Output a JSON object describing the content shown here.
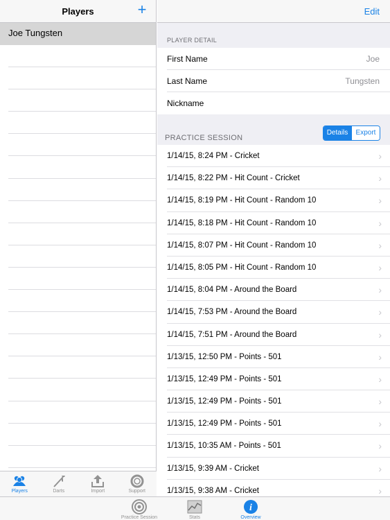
{
  "master": {
    "title": "Players",
    "add_symbol": "+",
    "players": [
      "Joe Tungsten"
    ],
    "empty_rows": 19,
    "tabs": [
      {
        "label": "Players",
        "icon": "players-icon",
        "active": true
      },
      {
        "label": "Darts",
        "icon": "dart-icon",
        "active": false
      },
      {
        "label": "Import",
        "icon": "import-icon",
        "active": false
      },
      {
        "label": "Support",
        "icon": "lifebuoy-icon",
        "active": false
      }
    ]
  },
  "detail": {
    "edit_label": "Edit",
    "player_detail_header": "PLAYER DETAIL",
    "fields": [
      {
        "label": "First Name",
        "value": "Joe"
      },
      {
        "label": "Last Name",
        "value": "Tungsten"
      },
      {
        "label": "Nickname",
        "value": ""
      }
    ],
    "practice_header": "PRACTICE SESSION",
    "segment": {
      "details": "Details",
      "export": "Export"
    },
    "sessions": [
      "1/14/15, 8:24 PM - Cricket",
      "1/14/15, 8:22 PM - Hit Count - Cricket",
      "1/14/15, 8:19 PM - Hit Count - Random 10",
      "1/14/15, 8:18 PM - Hit Count - Random 10",
      "1/14/15, 8:07 PM - Hit Count - Random 10",
      "1/14/15, 8:05 PM - Hit Count - Random 10",
      "1/14/15, 8:04 PM - Around the Board",
      "1/14/15, 7:53 PM - Around the Board",
      "1/14/15, 7:51 PM - Around the Board",
      "1/13/15, 12:50 PM - Points - 501",
      "1/13/15, 12:49 PM - Points - 501",
      "1/13/15, 12:49 PM - Points - 501",
      "1/13/15, 12:49 PM - Points - 501",
      "1/13/15, 10:35 AM - Points - 501",
      "1/13/15, 9:39 AM - Cricket",
      "1/13/15, 9:38 AM - Cricket"
    ]
  },
  "main_tabs": [
    {
      "label": "Practice Session",
      "icon": "target-icon",
      "active": false
    },
    {
      "label": "Stats",
      "icon": "stats-chart-icon",
      "active": false
    },
    {
      "label": "Overview",
      "icon": "info-icon",
      "active": true
    }
  ],
  "colors": {
    "accent": "#1a82e6",
    "selected_row": "#d6d6d6",
    "group_bg": "#efeff4"
  }
}
